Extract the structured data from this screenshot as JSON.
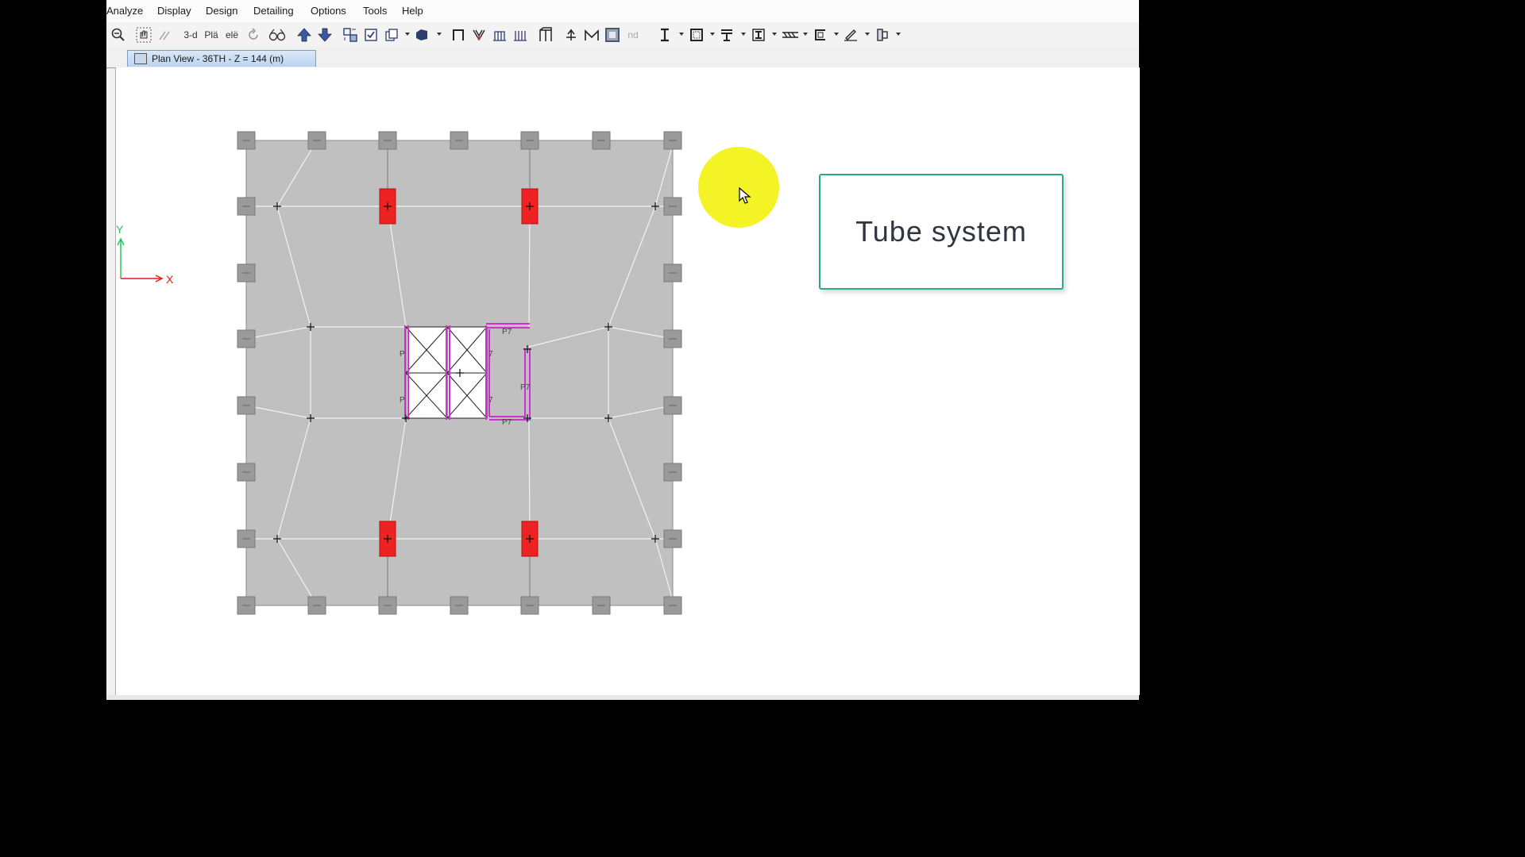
{
  "menu": {
    "items": [
      {
        "label": "Analyze"
      },
      {
        "label": "Display"
      },
      {
        "label": "Design"
      },
      {
        "label": "Detailing"
      },
      {
        "label": "Options"
      },
      {
        "label": "Tools"
      },
      {
        "label": "Help"
      }
    ]
  },
  "toolbar": {
    "view_3d_label": "3-d",
    "plan_label": "Plä",
    "elev_label": "elë",
    "nd_label": "nd"
  },
  "tab": {
    "label": "Plan View - 36TH - Z = 144 (m)"
  },
  "axes": {
    "y_label": "Y",
    "x_label": "X",
    "y_color": "#22c55e",
    "x_color": "#e11d1d"
  },
  "plan": {
    "slab_color": "#c0c0c0",
    "column_color": "#ee2222",
    "wall_color": "#cc33cc",
    "pier_labels": [
      "P7",
      "P7",
      "P7",
      "P",
      "P",
      "7",
      "7"
    ]
  },
  "callout": {
    "text": "Tube system"
  },
  "colors": {
    "highlight": "#f3f21a",
    "callout_border": "#2aa88a"
  }
}
